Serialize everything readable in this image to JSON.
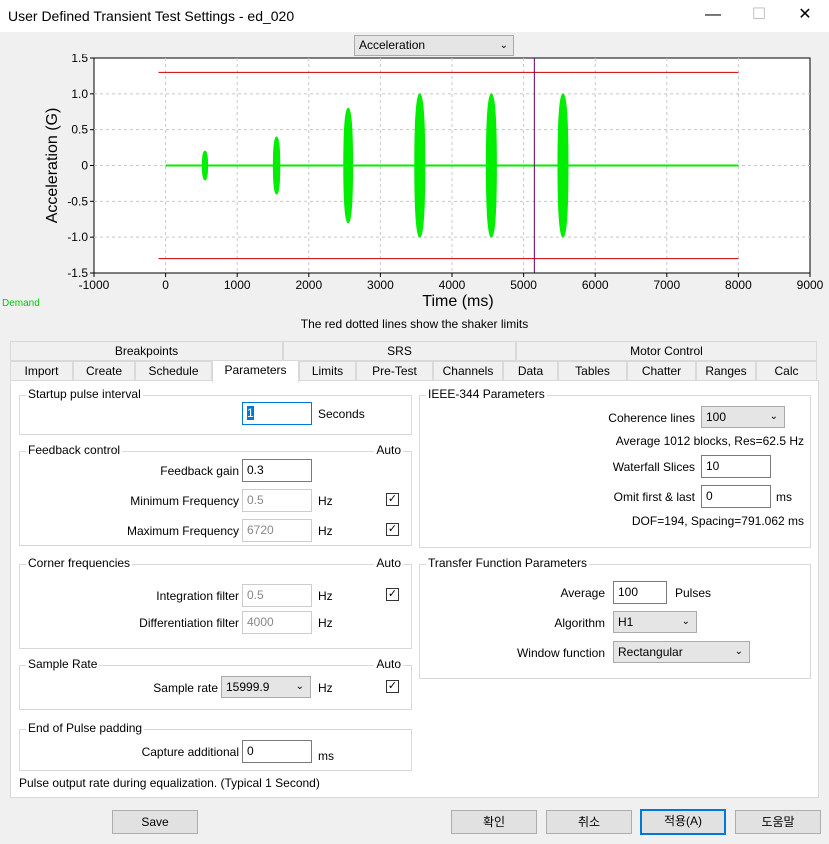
{
  "window": {
    "title": "User Defined Transient Test Settings - ed_020",
    "minimize": "—",
    "maximize": "☐",
    "close": "✕"
  },
  "plot": {
    "selector": "Acceleration",
    "demand_label": "Demand",
    "caption": "The red dotted lines show the shaker limits"
  },
  "chart_data": {
    "type": "line",
    "ylabel": "Acceleration (G)",
    "xlabel": "Time (ms)",
    "xlim": [
      -1000,
      9000
    ],
    "ylim": [
      -1.5,
      1.5
    ],
    "xticks": [
      "-1000",
      "0",
      "1000",
      "2000",
      "3000",
      "4000",
      "5000",
      "6000",
      "7000",
      "8000",
      "9000"
    ],
    "yticks": [
      "1.5",
      "1.0",
      "0.5",
      "0",
      "-0.5",
      "-1.0",
      "-1.5"
    ],
    "grid": true,
    "series": [
      {
        "color": "#00ee00",
        "x_range": [
          0,
          8000
        ],
        "pulses": [
          {
            "t": 550,
            "amp": 0.2
          },
          {
            "t": 1550,
            "amp": 0.4
          },
          {
            "t": 2550,
            "amp": 0.8
          },
          {
            "t": 3550,
            "amp": 1.0
          },
          {
            "t": 4550,
            "amp": 1.0
          },
          {
            "t": 5550,
            "amp": 1.0
          }
        ]
      }
    ],
    "limits": {
      "color": "#cc0000",
      "upper": 1.3,
      "lower": -1.3,
      "x_range": [
        -100,
        8000
      ]
    },
    "cursor": {
      "color": "#660066",
      "x": 5150
    }
  },
  "tabs": {
    "row1": [
      "Breakpoints",
      "SRS",
      "Motor Control"
    ],
    "row2": [
      "Import",
      "Create",
      "Schedule",
      "Parameters",
      "Limits",
      "Pre-Test",
      "Channels",
      "Data",
      "Tables",
      "Chatter",
      "Ranges",
      "Calc"
    ],
    "active": "Parameters"
  },
  "startup": {
    "title": "Startup pulse interval",
    "value": "1",
    "unit": "Seconds"
  },
  "feedback": {
    "title": "Feedback control",
    "auto": "Auto",
    "gain_label": "Feedback gain",
    "gain": "0.3",
    "min_label": "Minimum Frequency",
    "min": "0.5",
    "min_unit": "Hz",
    "max_label": "Maximum Frequency",
    "max": "6720",
    "max_unit": "Hz"
  },
  "corner": {
    "title": "Corner frequencies",
    "auto": "Auto",
    "int_label": "Integration filter",
    "int": "0.5",
    "int_unit": "Hz",
    "diff_label": "Differentiation filter",
    "diff": "4000",
    "diff_unit": "Hz"
  },
  "sample": {
    "title": "Sample Rate",
    "auto": "Auto",
    "label": "Sample rate",
    "value": "15999.9",
    "unit": "Hz"
  },
  "padding": {
    "title": "End of Pulse padding",
    "label": "Capture additional",
    "value": "0",
    "unit": "ms"
  },
  "note": "Pulse output rate during equalization. (Typical 1 Second)",
  "ieee": {
    "title": "IEEE-344 Parameters",
    "coh_label": "Coherence lines",
    "coh": "100",
    "avg_text": "Average 1012 blocks, Res=62.5 Hz",
    "wf_label": "Waterfall Slices",
    "wf": "10",
    "omit_label": "Omit first & last",
    "omit": "0",
    "omit_unit": "ms",
    "dof_text": "DOF=194, Spacing=791.062 ms"
  },
  "transfer": {
    "title": "Transfer Function Parameters",
    "avg_label": "Average",
    "avg": "100",
    "avg_unit": "Pulses",
    "alg_label": "Algorithm",
    "alg": "H1",
    "win_label": "Window function",
    "win": "Rectangular"
  },
  "buttons": {
    "save": "Save",
    "ok": "확인",
    "cancel": "취소",
    "apply": "적용(A)",
    "help": "도움말"
  }
}
